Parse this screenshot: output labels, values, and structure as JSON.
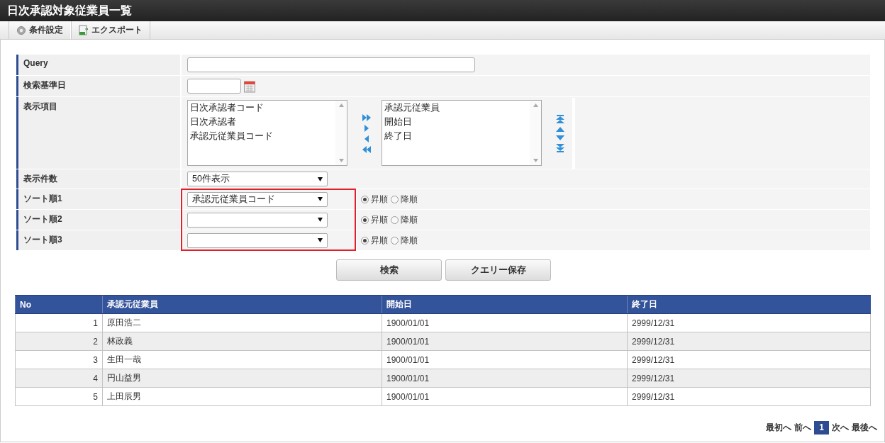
{
  "window": {
    "title": "日次承認対象従業員一覧"
  },
  "toolbar": [
    {
      "label": "条件設定",
      "kind": "settings"
    },
    {
      "label": "エクスポート",
      "kind": "export"
    }
  ],
  "form": {
    "query": {
      "label": "Query"
    },
    "base_date": {
      "label": "検索基準日"
    },
    "display_items": {
      "label": "表示項目",
      "available": [
        "日次承認者コード",
        "日次承認者",
        "承認元従業員コード"
      ],
      "chosen": [
        "承認元従業員",
        "開始日",
        "終了日"
      ]
    },
    "page_size": {
      "label": "表示件数",
      "value": "50件表示"
    },
    "sort": {
      "highlighted": true,
      "rows": [
        {
          "label": "ソート順1",
          "value": "承認元従業員コード",
          "orders": [
            {
              "label": "昇順",
              "selected": true
            },
            {
              "label": "降順",
              "selected": false
            }
          ]
        },
        {
          "label": "ソート順2",
          "orders": [
            {
              "label": "昇順",
              "selected": true
            },
            {
              "label": "降順",
              "selected": false
            }
          ]
        },
        {
          "label": "ソート順3",
          "orders": [
            {
              "label": "昇順",
              "selected": true
            },
            {
              "label": "降順",
              "selected": false
            }
          ]
        }
      ]
    }
  },
  "buttons": [
    "検索",
    "クエリー保存"
  ],
  "table": {
    "columns": [
      "No",
      "承認元従業員",
      "開始日",
      "終了日"
    ],
    "rows": [
      [
        "1",
        "原田浩二",
        "1900/01/01",
        "2999/12/31"
      ],
      [
        "2",
        "林政義",
        "1900/01/01",
        "2999/12/31"
      ],
      [
        "3",
        "生田一哉",
        "1900/01/01",
        "2999/12/31"
      ],
      [
        "4",
        "円山益男",
        "1900/01/01",
        "2999/12/31"
      ],
      [
        "5",
        "上田辰男",
        "1900/01/01",
        "2999/12/31"
      ]
    ]
  },
  "pager": {
    "first": "最初へ",
    "prev": "前へ",
    "pages": [
      {
        "label": "1",
        "selected": true
      }
    ],
    "next": "次へ",
    "last": "最後へ"
  }
}
